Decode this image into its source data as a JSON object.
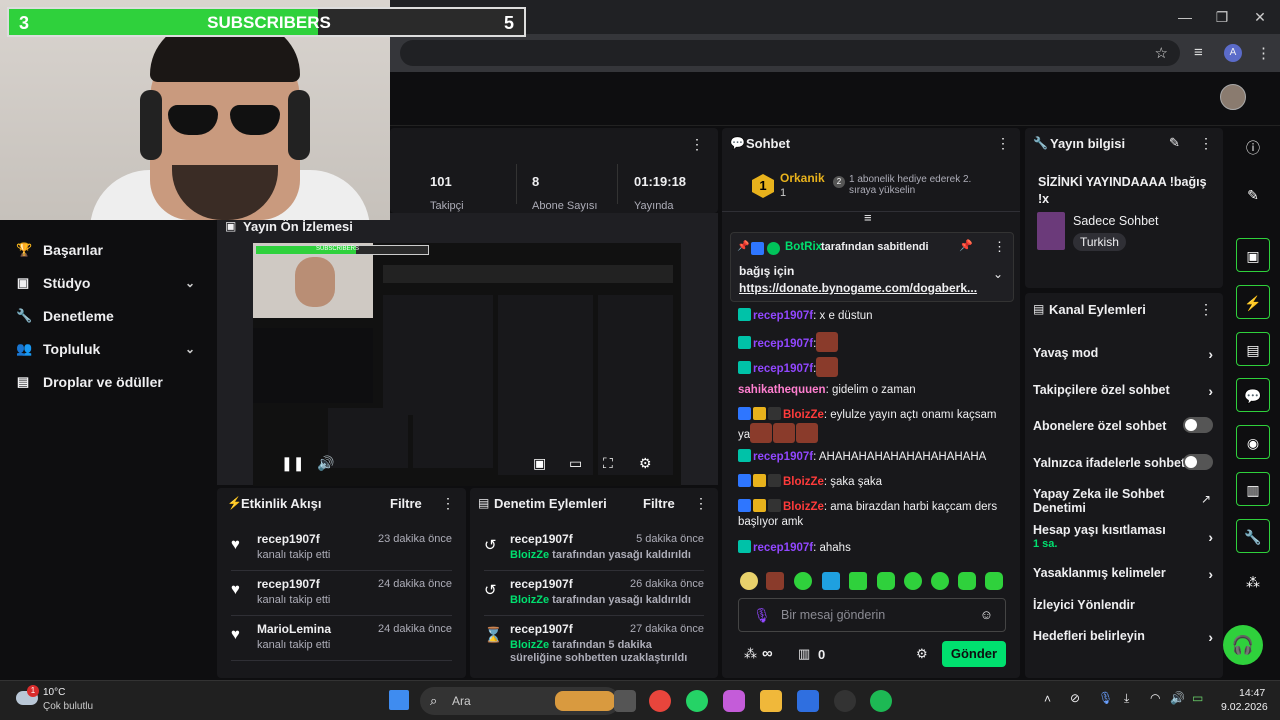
{
  "browser": {
    "tab_close": "×",
    "tab_add": "+",
    "win_min": "—",
    "win_max": "❐",
    "win_close": "✕"
  },
  "webcam": {
    "sub_left": "3",
    "sub_title": "SUBSCRIBERS",
    "sub_right": "5",
    "progress_fraction": 0.6
  },
  "nav": {
    "items": [
      {
        "label": "Başarılar",
        "icon": "trophy-icon"
      },
      {
        "label": "Stüdyo",
        "icon": "studio-icon",
        "chev": "⌄"
      },
      {
        "label": "Denetleme",
        "icon": "wrench-icon"
      },
      {
        "label": "Topluluk",
        "icon": "community-icon",
        "chev": "⌄"
      },
      {
        "label": "Droplar ve ödüller",
        "icon": "gift-icon"
      }
    ]
  },
  "stats": {
    "items": [
      {
        "value": "101",
        "label": "Takipçi"
      },
      {
        "value": "8",
        "label": "Abone Sayısı"
      },
      {
        "value": "01:19:18",
        "label": "Yayında"
      }
    ]
  },
  "preview": {
    "title": "Yayın Ön İzlemesi",
    "mini_sub": "SUBSCRIBERS"
  },
  "activity": {
    "title": "Etkinlik Akışı",
    "filter": "Filtre",
    "items": [
      {
        "user": "recep1907f",
        "text": "kanalı takip etti",
        "time": "23 dakika önce"
      },
      {
        "user": "recep1907f",
        "text": "kanalı takip etti",
        "time": "24 dakika önce"
      },
      {
        "user": "MarioLemina",
        "text": "kanalı takip etti",
        "time": "24 dakika önce"
      }
    ]
  },
  "modactions": {
    "title": "Denetim Eylemleri",
    "filter": "Filtre",
    "items": [
      {
        "user": "recep1907f",
        "by": "BloizZe",
        "text": " tarafından yasağı kaldırıldı",
        "time": "5 dakika önce"
      },
      {
        "user": "recep1907f",
        "by": "BloizZe",
        "text": " tarafından yasağı kaldırıldı",
        "time": "26 dakika önce"
      },
      {
        "user": "recep1907f",
        "by": "BloizZe",
        "text": " tarafından 5 dakika süreliğine sohbetten uzaklaştırıldı",
        "time": "27 dakika önce"
      }
    ]
  },
  "chat": {
    "title": "Sohbet",
    "leader_rank": "1",
    "leader_name": "Orkanik",
    "leader_count": "1",
    "gift_rank": "2",
    "gift_text": "1 abonelik hediye ederek 2. sıraya yükselin",
    "pinned_by": "BotRix",
    "pinned_suffix": " tarafından sabitlendi",
    "pinned_text": "bağış için",
    "pinned_link": "https://donate.bynogame.com/dogaberk...",
    "messages": [
      {
        "user": "recep1907f",
        "text": ": x e düstun",
        "color": "#9147ff"
      },
      {
        "user": "recep1907f",
        "text": ":",
        "color": "#9147ff"
      },
      {
        "user": "recep1907f",
        "text": ":",
        "color": "#9147ff"
      },
      {
        "user": "sahikathequuen",
        "text": ": gidelim o zaman",
        "color": "#ff7fd0"
      },
      {
        "user": "BloizZe",
        "text": ": eylulze yayın açtı onamı kaçsam ya",
        "color": "#ff3b3b"
      },
      {
        "user": "recep1907f",
        "text": ": AHAHAHAHAHAHAHAHAHAHA",
        "color": "#9147ff"
      },
      {
        "user": "BloizZe",
        "text": ": şaka şaka",
        "color": "#ff3b3b"
      },
      {
        "user": "BloizZe",
        "text": ": ama birazdan harbi kaçcam ders başlıyor amk",
        "color": "#ff3b3b"
      },
      {
        "user": "recep1907f",
        "text": ": ahahs",
        "color": "#9147ff"
      }
    ],
    "placeholder": "Bir mesaj gönderin",
    "points": "∞",
    "gifts": "0",
    "send": "Gönder"
  },
  "info": {
    "title": "Yayın bilgisi",
    "stream_title": "SİZİNKİ YAYINDAAAA !bağış !x",
    "category": "Sadece Sohbet",
    "tag": "Turkish"
  },
  "actions": {
    "title": "Kanal Eylemleri",
    "items": [
      {
        "label": "Yavaş mod",
        "kind": "chev"
      },
      {
        "label": "Takipçilere özel sohbet",
        "kind": "chev"
      },
      {
        "label": "Abonelere özel sohbet",
        "kind": "toggle"
      },
      {
        "label": "Yalnızca ifadelerle sohbet",
        "kind": "toggle"
      },
      {
        "label": "Yapay Zeka ile Sohbet Denetimi",
        "kind": "ext"
      },
      {
        "label": "Hesap yaşı kısıtlaması",
        "kind": "chev",
        "sub": "1 sa."
      },
      {
        "label": "Yasaklanmış kelimeler",
        "kind": "chev"
      },
      {
        "label": "İzleyici Yönlendir",
        "kind": "none"
      },
      {
        "label": "Hedefleri belirleyin",
        "kind": "chev"
      }
    ]
  },
  "taskbar": {
    "weather_temp": "10°C",
    "weather_desc": "Çok bulutlu",
    "weather_badge": "1",
    "search": "Ara",
    "time": "14:47",
    "date": "9.02.2026"
  },
  "colors": {
    "accent": "#00e06f",
    "twitch_purple": "#9147ff",
    "sub_green": "#2fd13c"
  }
}
